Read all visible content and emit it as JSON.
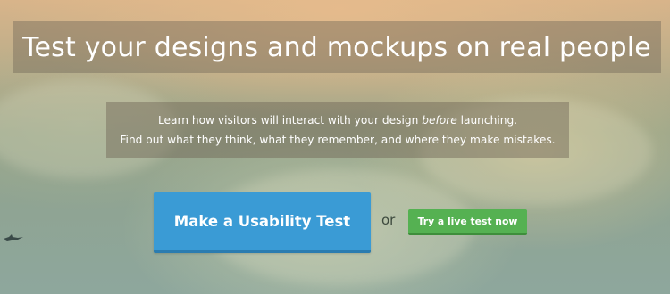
{
  "hero": {
    "heading": "Test your designs and mockups on real people",
    "description": {
      "line1_pre": "Learn how visitors will interact with your design ",
      "line1_emphasis": "before",
      "line1_post": " launching.",
      "line2": "Find out what they think, what they remember, and where they make mistakes."
    },
    "primary_button": "Make a Usability Test",
    "separator": "or",
    "secondary_button": "Try a live test now"
  },
  "colors": {
    "primary_button": "#3a9bd5",
    "secondary_button": "#55b152",
    "overlay": "rgba(110,100,85,0.45)"
  },
  "icons": [
    "bird-silhouette-icon"
  ]
}
